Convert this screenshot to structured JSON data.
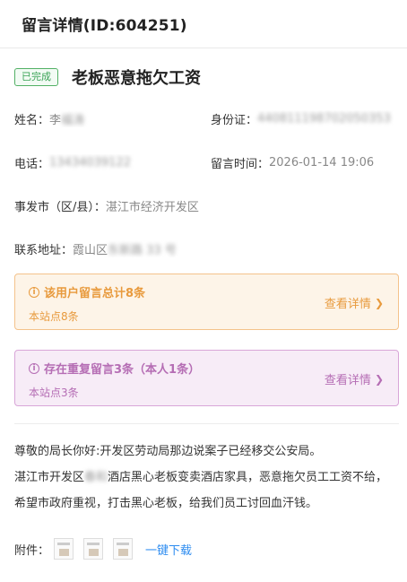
{
  "header": {
    "title": "留言详情(ID:604251)"
  },
  "message": {
    "status": "已完成",
    "title": "老板恶意拖欠工资",
    "name_label": "姓名：",
    "name_value": "李福涛",
    "id_label": "身份证：",
    "id_value": "440811198702050353",
    "phone_label": "电话：",
    "phone_value": "13434039122",
    "time_label": "留言时间：",
    "time_value": "2026-01-14 19:06",
    "city_label": "事发市（区/县）：",
    "city_value": "湛江市经济开发区",
    "address_label": "联系地址：",
    "address_prefix": "霞山区",
    "address_hidden": "东新路 33 号"
  },
  "cards": {
    "total": {
      "icon": "info-icon",
      "text": "该用户留言总计8条",
      "subtext": "本站点8条",
      "link": "查看详情"
    },
    "duplicate": {
      "icon": "info-icon",
      "text": "存在重复留言3条（本人1条）",
      "subtext": "本站点3条",
      "link": "查看详情"
    }
  },
  "content": {
    "line1": "尊敬的局长你好:开发区劳动局那边说案子已经移交公安局。",
    "line2_a": "湛江市开发区",
    "line2_hidden": "春和",
    "line2_b": "酒店黑心老板变卖酒店家具，恶意拖欠员工工资不给，希望市政府重视，打击黑心老板，给我们员工讨回血汗钱。"
  },
  "attachments": {
    "label": "附件：",
    "download": "一键下载",
    "count": 3
  },
  "colors": {
    "status_green": "#3aa356",
    "orange": "#e89a3d",
    "purple": "#b56db4",
    "link_blue": "#2d8cf0"
  }
}
